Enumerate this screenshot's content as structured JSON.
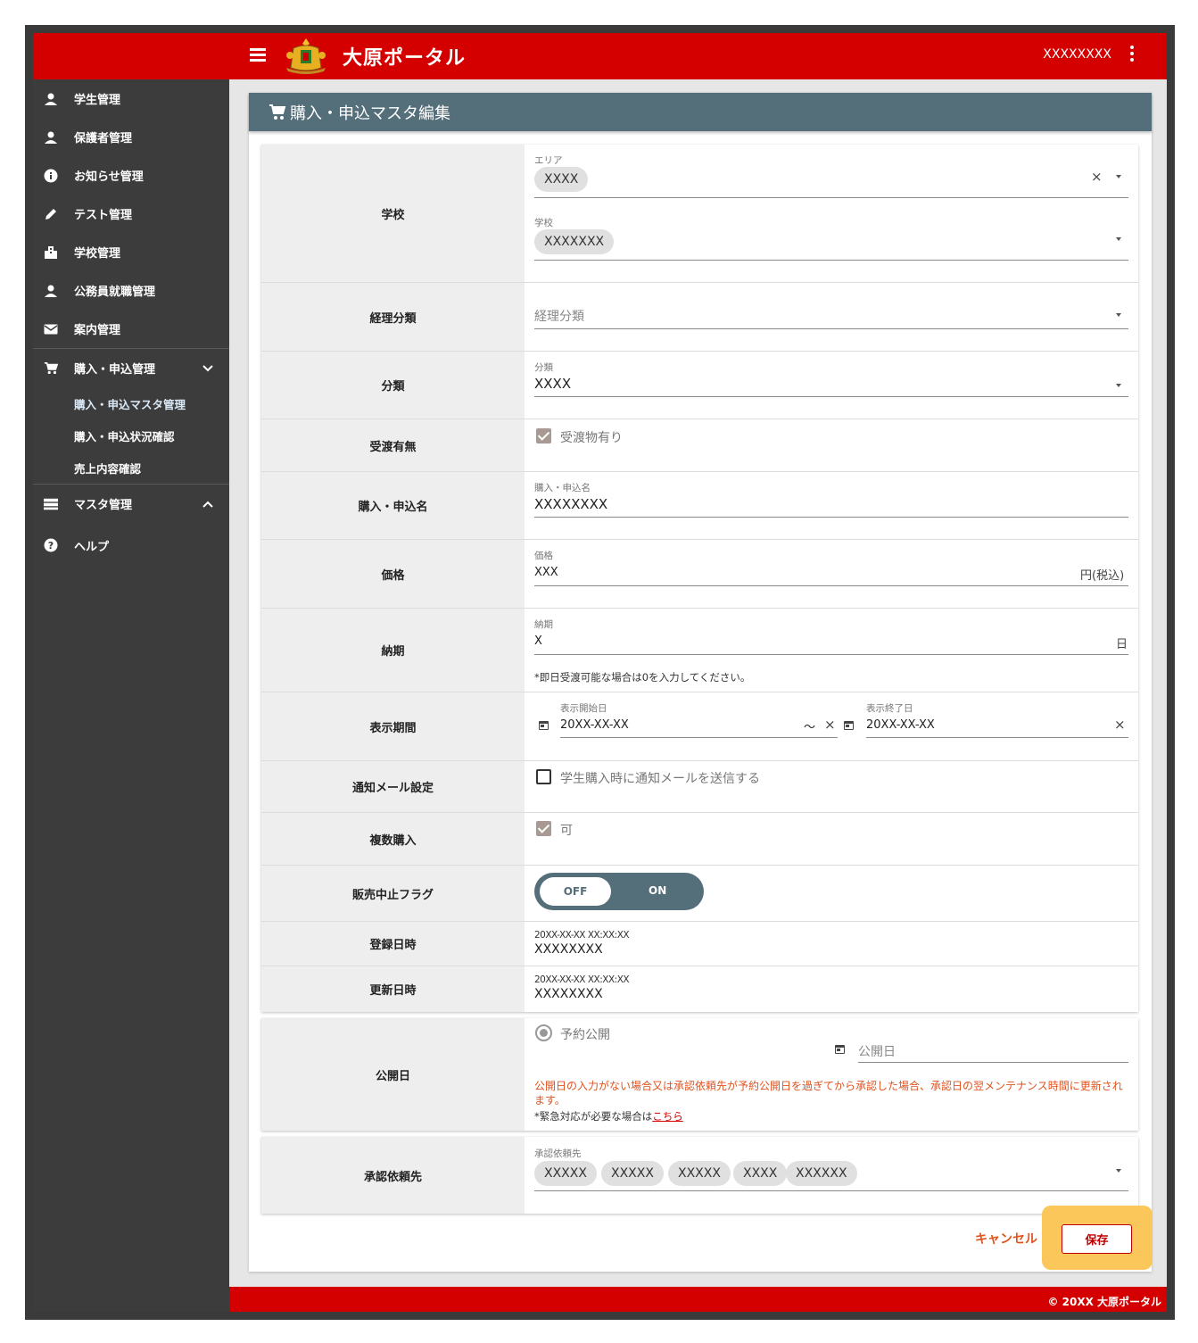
{
  "app": {
    "title": "大原ポータル",
    "user": "XXXXXXXX",
    "footer": "© 20XX 大原ポータル"
  },
  "colors": {
    "brand": "#d40000",
    "header_bar": "#546e7a",
    "sidebar": "#3c3c3c",
    "accent_orange": "#e0531f",
    "highlight": "#fbc65a"
  },
  "sidebar": {
    "items": [
      {
        "label": "学生管理",
        "icon": "person-icon"
      },
      {
        "label": "保護者管理",
        "icon": "person-icon"
      },
      {
        "label": "お知らせ管理",
        "icon": "info-icon"
      },
      {
        "label": "テスト管理",
        "icon": "pencil-icon"
      },
      {
        "label": "学校管理",
        "icon": "building-icon"
      },
      {
        "label": "公務員就職管理",
        "icon": "person-icon"
      },
      {
        "label": "案内管理",
        "icon": "mail-icon"
      },
      {
        "label": "購入・申込管理",
        "icon": "cart-icon"
      },
      {
        "label": "マスタ管理",
        "icon": "storage-icon"
      },
      {
        "label": "ヘルプ",
        "icon": "help-icon"
      }
    ],
    "sub_items": [
      "購入・申込マスタ管理",
      "購入・申込状況確認",
      "売上内容確認"
    ],
    "active_sub": "購入・申込マスタ管理"
  },
  "page": {
    "title": "購入・申込マスタ編集"
  },
  "form": {
    "school": {
      "label": "学校",
      "area_label": "エリア",
      "area_value": "XXXX",
      "school_label": "学校",
      "school_value": "XXXXXXX"
    },
    "accounting": {
      "label": "経理分類",
      "placeholder": "経理分類"
    },
    "category": {
      "label": "分類",
      "field_label": "分類",
      "value": "XXXX"
    },
    "delivery": {
      "label": "受渡有無",
      "checkbox_label": "受渡物有り",
      "checked": true
    },
    "name": {
      "label": "購入・申込名",
      "field_label": "購入・申込名",
      "value": "XXXXXXXX"
    },
    "price": {
      "label": "価格",
      "field_label": "価格",
      "value": "XXX",
      "suffix": "円(税込)"
    },
    "delivery_days": {
      "label": "納期",
      "field_label": "納期",
      "value": "X",
      "suffix": "日",
      "note": "*即日受渡可能な場合は0を入力してください。"
    },
    "display_period": {
      "label": "表示期間",
      "start_label": "表示開始日",
      "start_value": "20XX-XX-XX",
      "separator": "～",
      "end_label": "表示終了日",
      "end_value": "20XX-XX-XX"
    },
    "notify": {
      "label": "通知メール設定",
      "checkbox_label": "学生購入時に通知メールを送信する",
      "checked": false
    },
    "multiple": {
      "label": "複数購入",
      "checkbox_label": "可",
      "checked": true
    },
    "stop_flag": {
      "label": "販売中止フラグ",
      "off_label": "OFF",
      "on_label": "ON",
      "state": "OFF"
    },
    "registered": {
      "label": "登録日時",
      "datetime": "20XX-XX-XX XX:XX:XX",
      "user": "XXXXXXXX"
    },
    "updated": {
      "label": "更新日時",
      "datetime": "20XX-XX-XX XX:XX:XX",
      "user": "XXXXXXXX"
    },
    "publish": {
      "label": "公開日",
      "radio_label": "予約公開",
      "date_placeholder": "公開日",
      "note_red": "公開日の入力がない場合又は承認依頼先が予約公開日を過ぎてから承認した場合、承認日の翌メンテナンス時間に更新されます。",
      "note_prefix": "*緊急対応が必要な場合は",
      "note_link": "こちら"
    },
    "approver": {
      "label": "承認依頼先",
      "field_label": "承認依頼先",
      "chips": [
        "XXXXX",
        "XXXXX",
        "XXXXX",
        "XXXX",
        "XXXXXX"
      ]
    }
  },
  "actions": {
    "cancel": "キャンセル",
    "save": "保存"
  }
}
